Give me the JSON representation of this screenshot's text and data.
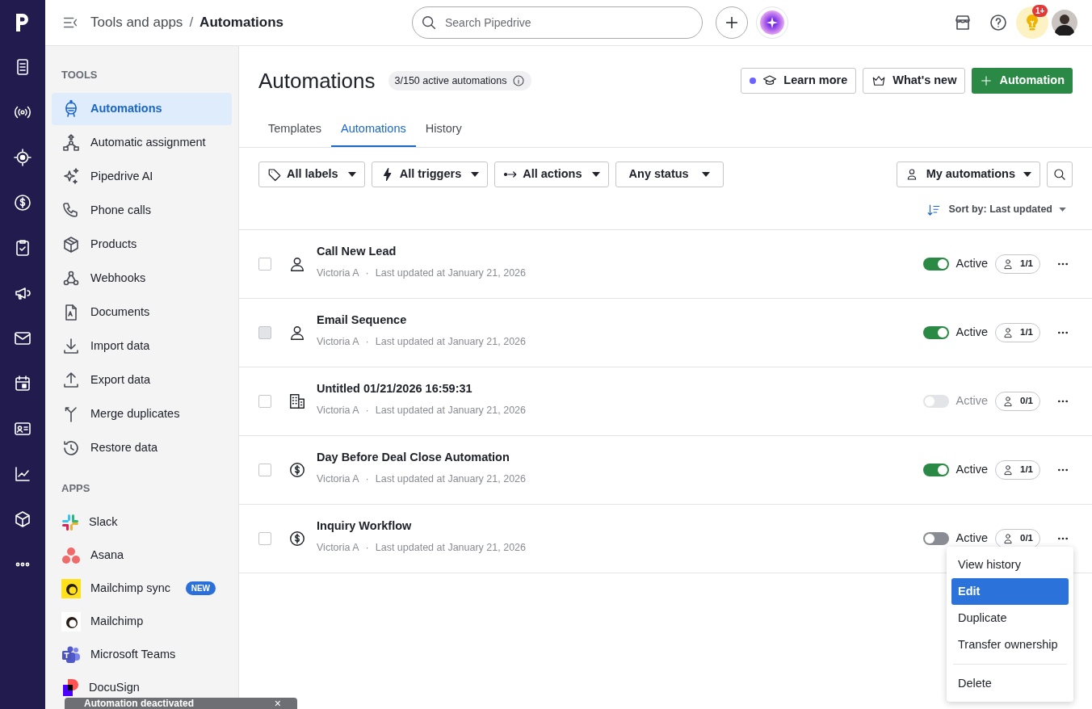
{
  "breadcrumb": {
    "parent": "Tools and apps",
    "separator": "/",
    "current": "Automations"
  },
  "search": {
    "placeholder": "Search Pipedrive"
  },
  "notifications": {
    "badge": "1+"
  },
  "sidebar": {
    "tools_heading": "TOOLS",
    "tools": [
      {
        "label": "Automations",
        "selected": true
      },
      {
        "label": "Automatic assignment",
        "selected": false
      },
      {
        "label": "Pipedrive AI",
        "selected": false
      },
      {
        "label": "Phone calls",
        "selected": false
      },
      {
        "label": "Products",
        "selected": false
      },
      {
        "label": "Webhooks",
        "selected": false
      },
      {
        "label": "Documents",
        "selected": false
      },
      {
        "label": "Import data",
        "selected": false
      },
      {
        "label": "Export data",
        "selected": false
      },
      {
        "label": "Merge duplicates",
        "selected": false
      },
      {
        "label": "Restore data",
        "selected": false
      }
    ],
    "apps_heading": "APPS",
    "apps": [
      {
        "label": "Slack"
      },
      {
        "label": "Asana"
      },
      {
        "label": "Mailchimp sync",
        "badge": "NEW"
      },
      {
        "label": "Mailchimp"
      },
      {
        "label": "Microsoft Teams"
      },
      {
        "label": "DocuSign"
      }
    ]
  },
  "page": {
    "title": "Automations",
    "counter": "3/150 active automations",
    "buttons": [
      {
        "label": "Learn more",
        "kind": "learn"
      },
      {
        "label": "What's new",
        "kind": "news"
      },
      {
        "label": "Automation",
        "kind": "primary"
      }
    ]
  },
  "tabs": [
    {
      "label": "Templates",
      "selected": false
    },
    {
      "label": "Automations",
      "selected": true
    },
    {
      "label": "History",
      "selected": false
    }
  ],
  "filters": [
    {
      "label": "All labels",
      "kind": "tag"
    },
    {
      "label": "All triggers",
      "kind": "bolt"
    },
    {
      "label": "All actions",
      "kind": "action"
    },
    {
      "label": "Any status",
      "kind": "none"
    }
  ],
  "owner_filter": "My automations",
  "sort": "Sort by: Last updated",
  "rows": [
    {
      "title": "Call New Lead",
      "owner": "Victoria A",
      "separator": "·",
      "updated": "Last updated at January 21, 2026",
      "kind": "person",
      "checkbox_hover": false,
      "active": true,
      "disabled": false,
      "status": "Active",
      "users": "1/1"
    },
    {
      "title": "Email Sequence",
      "owner": "Victoria A",
      "separator": "·",
      "updated": "Last updated at January 21, 2026",
      "kind": "person",
      "checkbox_hover": true,
      "active": true,
      "disabled": false,
      "status": "Active",
      "users": "1/1"
    },
    {
      "title": "Untitled 01/21/2026 16:59:31",
      "owner": "Victoria A",
      "separator": "·",
      "updated": "Last updated at January 21, 2026",
      "kind": "organization",
      "checkbox_hover": false,
      "active": false,
      "disabled": true,
      "status": "Active",
      "users": "0/1"
    },
    {
      "title": "Day Before Deal Close Automation",
      "owner": "Victoria A",
      "separator": "·",
      "updated": "Last updated at January 21, 2026",
      "kind": "deal",
      "checkbox_hover": false,
      "active": true,
      "disabled": false,
      "status": "Active",
      "users": "1/1"
    },
    {
      "title": "Inquiry Workflow",
      "owner": "Victoria A",
      "separator": "·",
      "updated": "Last updated at January 21, 2026",
      "kind": "deal",
      "checkbox_hover": false,
      "active": false,
      "disabled": false,
      "status": "Active",
      "users": "0/1"
    }
  ],
  "menu": {
    "items": [
      {
        "label": "View history",
        "selected": false,
        "kind": "item"
      },
      {
        "label": "Edit",
        "selected": true,
        "kind": "item"
      },
      {
        "label": "Duplicate",
        "selected": false,
        "kind": "item"
      },
      {
        "label": "Transfer ownership",
        "selected": false,
        "kind": "item"
      },
      {
        "label": "Delete",
        "selected": false,
        "kind": "danger"
      }
    ]
  },
  "toast": {
    "message": "Automation deactivated",
    "close": "×"
  }
}
